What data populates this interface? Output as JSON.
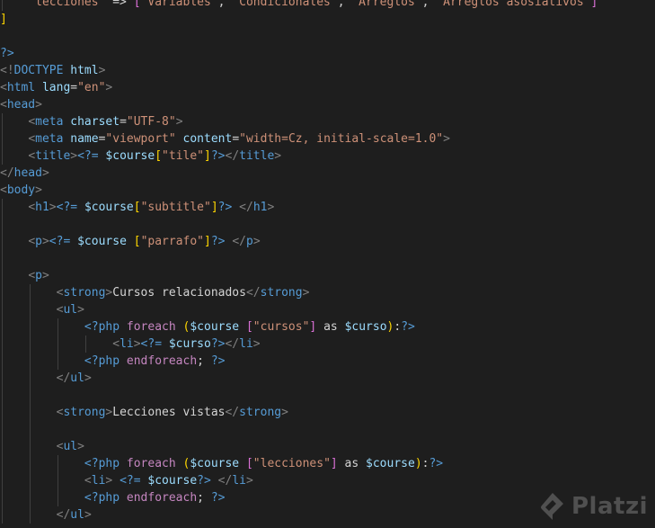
{
  "editor": {
    "language": "php",
    "colors": {
      "background": "#1e1e1e",
      "tag": "#569cd6",
      "attribute": "#9cdcfe",
      "string": "#ce9178",
      "keyword": "#c586c0",
      "variable": "#9cdcfe",
      "punctuation": "#808080",
      "bracket": "#ffd700"
    },
    "lines": [
      {
        "indent": 1,
        "tokens": [
          [
            "str",
            "\"lecciones\""
          ],
          [
            "op",
            " => "
          ],
          [
            "br2",
            "["
          ],
          [
            "str",
            "\"Variables\""
          ],
          [
            "op",
            ", "
          ],
          [
            "str",
            "\"Condicionales\""
          ],
          [
            "op",
            ", "
          ],
          [
            "str",
            "\"Arreglos\""
          ],
          [
            "op",
            ", "
          ],
          [
            "str",
            "\"Arreglos asosiativos\""
          ],
          [
            "br2",
            "]"
          ]
        ]
      },
      {
        "indent": 0,
        "tokens": [
          [
            "br",
            "]"
          ]
        ]
      },
      {
        "indent": 0,
        "tokens": []
      },
      {
        "indent": 0,
        "tokens": [
          [
            "php",
            "?>"
          ]
        ]
      },
      {
        "indent": 0,
        "tokens": [
          [
            "sym",
            "<!"
          ],
          [
            "tag",
            "DOCTYPE"
          ],
          [
            "op",
            " "
          ],
          [
            "attr",
            "html"
          ],
          [
            "sym",
            ">"
          ]
        ]
      },
      {
        "indent": 0,
        "tokens": [
          [
            "sym",
            "<"
          ],
          [
            "tag",
            "html"
          ],
          [
            "op",
            " "
          ],
          [
            "attr",
            "lang"
          ],
          [
            "op",
            "="
          ],
          [
            "str",
            "\"en\""
          ],
          [
            "sym",
            ">"
          ]
        ]
      },
      {
        "indent": 0,
        "tokens": [
          [
            "sym",
            "<"
          ],
          [
            "tag",
            "head"
          ],
          [
            "sym",
            ">"
          ]
        ]
      },
      {
        "indent": 1,
        "tokens": [
          [
            "sym",
            "<"
          ],
          [
            "tag",
            "meta"
          ],
          [
            "op",
            " "
          ],
          [
            "attr",
            "charset"
          ],
          [
            "op",
            "="
          ],
          [
            "str",
            "\"UTF-8\""
          ],
          [
            "sym",
            ">"
          ]
        ]
      },
      {
        "indent": 1,
        "tokens": [
          [
            "sym",
            "<"
          ],
          [
            "tag",
            "meta"
          ],
          [
            "op",
            " "
          ],
          [
            "attr",
            "name"
          ],
          [
            "op",
            "="
          ],
          [
            "str",
            "\"viewport\""
          ],
          [
            "op",
            " "
          ],
          [
            "attr",
            "content"
          ],
          [
            "op",
            "="
          ],
          [
            "str",
            "\"width=Cz, initial-scale=1.0\""
          ],
          [
            "sym",
            ">"
          ]
        ]
      },
      {
        "indent": 1,
        "tokens": [
          [
            "sym",
            "<"
          ],
          [
            "tag",
            "title"
          ],
          [
            "sym",
            ">"
          ],
          [
            "php",
            "<?="
          ],
          [
            "op",
            " "
          ],
          [
            "var",
            "$course"
          ],
          [
            "br",
            "["
          ],
          [
            "str",
            "\"tile\""
          ],
          [
            "br",
            "]"
          ],
          [
            "php",
            "?>"
          ],
          [
            "sym",
            "</"
          ],
          [
            "tag",
            "title"
          ],
          [
            "sym",
            ">"
          ]
        ]
      },
      {
        "indent": 0,
        "tokens": [
          [
            "sym",
            "</"
          ],
          [
            "tag",
            "head"
          ],
          [
            "sym",
            ">"
          ]
        ]
      },
      {
        "indent": 0,
        "tokens": [
          [
            "sym",
            "<"
          ],
          [
            "tag",
            "body"
          ],
          [
            "sym",
            ">"
          ]
        ]
      },
      {
        "indent": 1,
        "tokens": [
          [
            "sym",
            "<"
          ],
          [
            "tag",
            "h1"
          ],
          [
            "sym",
            ">"
          ],
          [
            "php",
            "<?="
          ],
          [
            "op",
            " "
          ],
          [
            "var",
            "$course"
          ],
          [
            "br",
            "["
          ],
          [
            "str",
            "\"subtitle\""
          ],
          [
            "br",
            "]"
          ],
          [
            "php",
            "?>"
          ],
          [
            "op",
            " "
          ],
          [
            "sym",
            "</"
          ],
          [
            "tag",
            "h1"
          ],
          [
            "sym",
            ">"
          ]
        ]
      },
      {
        "indent": 1,
        "tokens": [],
        "guides": 1
      },
      {
        "indent": 1,
        "tokens": [
          [
            "sym",
            "<"
          ],
          [
            "tag",
            "p"
          ],
          [
            "sym",
            ">"
          ],
          [
            "php",
            "<?="
          ],
          [
            "op",
            " "
          ],
          [
            "var",
            "$course"
          ],
          [
            "op",
            " "
          ],
          [
            "br",
            "["
          ],
          [
            "str",
            "\"parrafo\""
          ],
          [
            "br",
            "]"
          ],
          [
            "php",
            "?>"
          ],
          [
            "op",
            " "
          ],
          [
            "sym",
            "</"
          ],
          [
            "tag",
            "p"
          ],
          [
            "sym",
            ">"
          ]
        ]
      },
      {
        "indent": 1,
        "tokens": [],
        "guides": 1
      },
      {
        "indent": 1,
        "tokens": [
          [
            "sym",
            "<"
          ],
          [
            "tag",
            "p"
          ],
          [
            "sym",
            ">"
          ]
        ]
      },
      {
        "indent": 2,
        "tokens": [
          [
            "sym",
            "<"
          ],
          [
            "tag",
            "strong"
          ],
          [
            "sym",
            ">"
          ],
          [
            "txt",
            "Cursos relacionados"
          ],
          [
            "sym",
            "</"
          ],
          [
            "tag",
            "strong"
          ],
          [
            "sym",
            ">"
          ]
        ]
      },
      {
        "indent": 2,
        "tokens": [
          [
            "sym",
            "<"
          ],
          [
            "tag",
            "ul"
          ],
          [
            "sym",
            ">"
          ]
        ]
      },
      {
        "indent": 3,
        "tokens": [
          [
            "php",
            "<?php"
          ],
          [
            "op",
            " "
          ],
          [
            "kw",
            "foreach"
          ],
          [
            "op",
            " "
          ],
          [
            "br",
            "("
          ],
          [
            "var",
            "$course"
          ],
          [
            "op",
            " "
          ],
          [
            "br2",
            "["
          ],
          [
            "str",
            "\"cursos\""
          ],
          [
            "br2",
            "]"
          ],
          [
            "op",
            " as "
          ],
          [
            "var",
            "$curso"
          ],
          [
            "br",
            ")"
          ],
          [
            "op",
            ":"
          ],
          [
            "php",
            "?>"
          ]
        ]
      },
      {
        "indent": 4,
        "tokens": [
          [
            "sym",
            "<"
          ],
          [
            "tag",
            "li"
          ],
          [
            "sym",
            ">"
          ],
          [
            "php",
            "<?="
          ],
          [
            "op",
            " "
          ],
          [
            "var",
            "$curso"
          ],
          [
            "php",
            "?>"
          ],
          [
            "sym",
            "</"
          ],
          [
            "tag",
            "li"
          ],
          [
            "sym",
            ">"
          ]
        ]
      },
      {
        "indent": 3,
        "tokens": [
          [
            "php",
            "<?php"
          ],
          [
            "op",
            " "
          ],
          [
            "kw",
            "endforeach"
          ],
          [
            "op",
            "; "
          ],
          [
            "php",
            "?>"
          ]
        ]
      },
      {
        "indent": 2,
        "tokens": [
          [
            "sym",
            "</"
          ],
          [
            "tag",
            "ul"
          ],
          [
            "sym",
            ">"
          ]
        ]
      },
      {
        "indent": 2,
        "tokens": [],
        "guides": 2
      },
      {
        "indent": 2,
        "tokens": [
          [
            "sym",
            "<"
          ],
          [
            "tag",
            "strong"
          ],
          [
            "sym",
            ">"
          ],
          [
            "txt",
            "Lecciones vistas"
          ],
          [
            "sym",
            "</"
          ],
          [
            "tag",
            "strong"
          ],
          [
            "sym",
            ">"
          ]
        ]
      },
      {
        "indent": 2,
        "tokens": [],
        "guides": 2
      },
      {
        "indent": 2,
        "tokens": [
          [
            "sym",
            "<"
          ],
          [
            "tag",
            "ul"
          ],
          [
            "sym",
            ">"
          ]
        ]
      },
      {
        "indent": 3,
        "tokens": [
          [
            "php",
            "<?php"
          ],
          [
            "op",
            " "
          ],
          [
            "kw",
            "foreach"
          ],
          [
            "op",
            " "
          ],
          [
            "br",
            "("
          ],
          [
            "var",
            "$course"
          ],
          [
            "op",
            " "
          ],
          [
            "br2",
            "["
          ],
          [
            "str",
            "\"lecciones\""
          ],
          [
            "br2",
            "]"
          ],
          [
            "op",
            " as "
          ],
          [
            "var",
            "$course"
          ],
          [
            "br",
            ")"
          ],
          [
            "op",
            ":"
          ],
          [
            "php",
            "?>"
          ]
        ]
      },
      {
        "indent": 3,
        "tokens": [
          [
            "sym",
            "<"
          ],
          [
            "tag",
            "li"
          ],
          [
            "sym",
            ">"
          ],
          [
            "op",
            " "
          ],
          [
            "php",
            "<?="
          ],
          [
            "op",
            " "
          ],
          [
            "var",
            "$course"
          ],
          [
            "php",
            "?>"
          ],
          [
            "op",
            " "
          ],
          [
            "sym",
            "</"
          ],
          [
            "tag",
            "li"
          ],
          [
            "sym",
            ">"
          ]
        ]
      },
      {
        "indent": 3,
        "tokens": [
          [
            "php",
            "<?php"
          ],
          [
            "op",
            " "
          ],
          [
            "kw",
            "endforeach"
          ],
          [
            "op",
            "; "
          ],
          [
            "php",
            "?>"
          ]
        ]
      },
      {
        "indent": 2,
        "tokens": [
          [
            "sym",
            "</"
          ],
          [
            "tag",
            "ul"
          ],
          [
            "sym",
            ">"
          ]
        ]
      }
    ]
  },
  "watermark": {
    "text": "Platzi",
    "logo_icon": "platzi-logo-icon"
  }
}
